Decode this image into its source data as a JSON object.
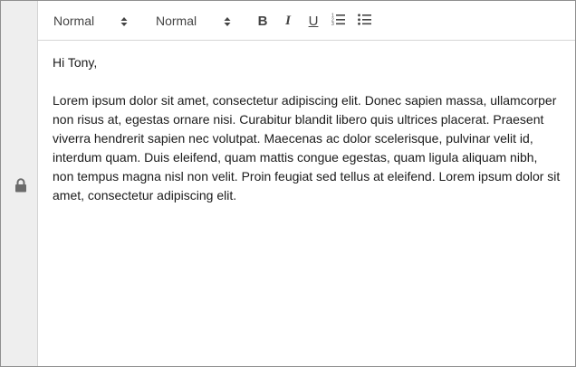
{
  "toolbar": {
    "header_picker": {
      "selected": "Normal",
      "icon": "up-down-arrows-icon"
    },
    "size_picker": {
      "selected": "Normal",
      "icon": "up-down-arrows-icon"
    },
    "buttons": {
      "bold": {
        "glyph": "B",
        "icon": "bold-icon"
      },
      "italic": {
        "glyph": "I",
        "icon": "italic-icon"
      },
      "underline": {
        "glyph": "U",
        "icon": "underline-icon"
      },
      "ordered_list": {
        "icon": "ordered-list-icon"
      },
      "bullet_list": {
        "icon": "bullet-list-icon"
      }
    }
  },
  "gutter": {
    "icon": "lock-icon",
    "color": "#6b6b6b"
  },
  "editor": {
    "greeting": "Hi Tony,",
    "body": "Lorem ipsum dolor sit amet, consectetur adipiscing elit. Donec sapien massa, ullamcorper non risus at, egestas ornare nisi. Curabitur blandit libero quis ultrices placerat. Praesent viverra hendrerit sapien nec volutpat. Maecenas ac dolor scelerisque, pulvinar velit id, interdum quam. Duis eleifend, quam mattis congue egestas, quam ligula aliquam nibh, non tempus magna nisl non velit. Proin feugiat sed tellus at eleifend. Lorem ipsum dolor sit amet, consectetur adipiscing elit."
  },
  "colors": {
    "gutter_bg": "#eeeeee",
    "toolbar_text": "#444444",
    "body_text": "#1a1a1a",
    "border": "#8f8f8f"
  }
}
